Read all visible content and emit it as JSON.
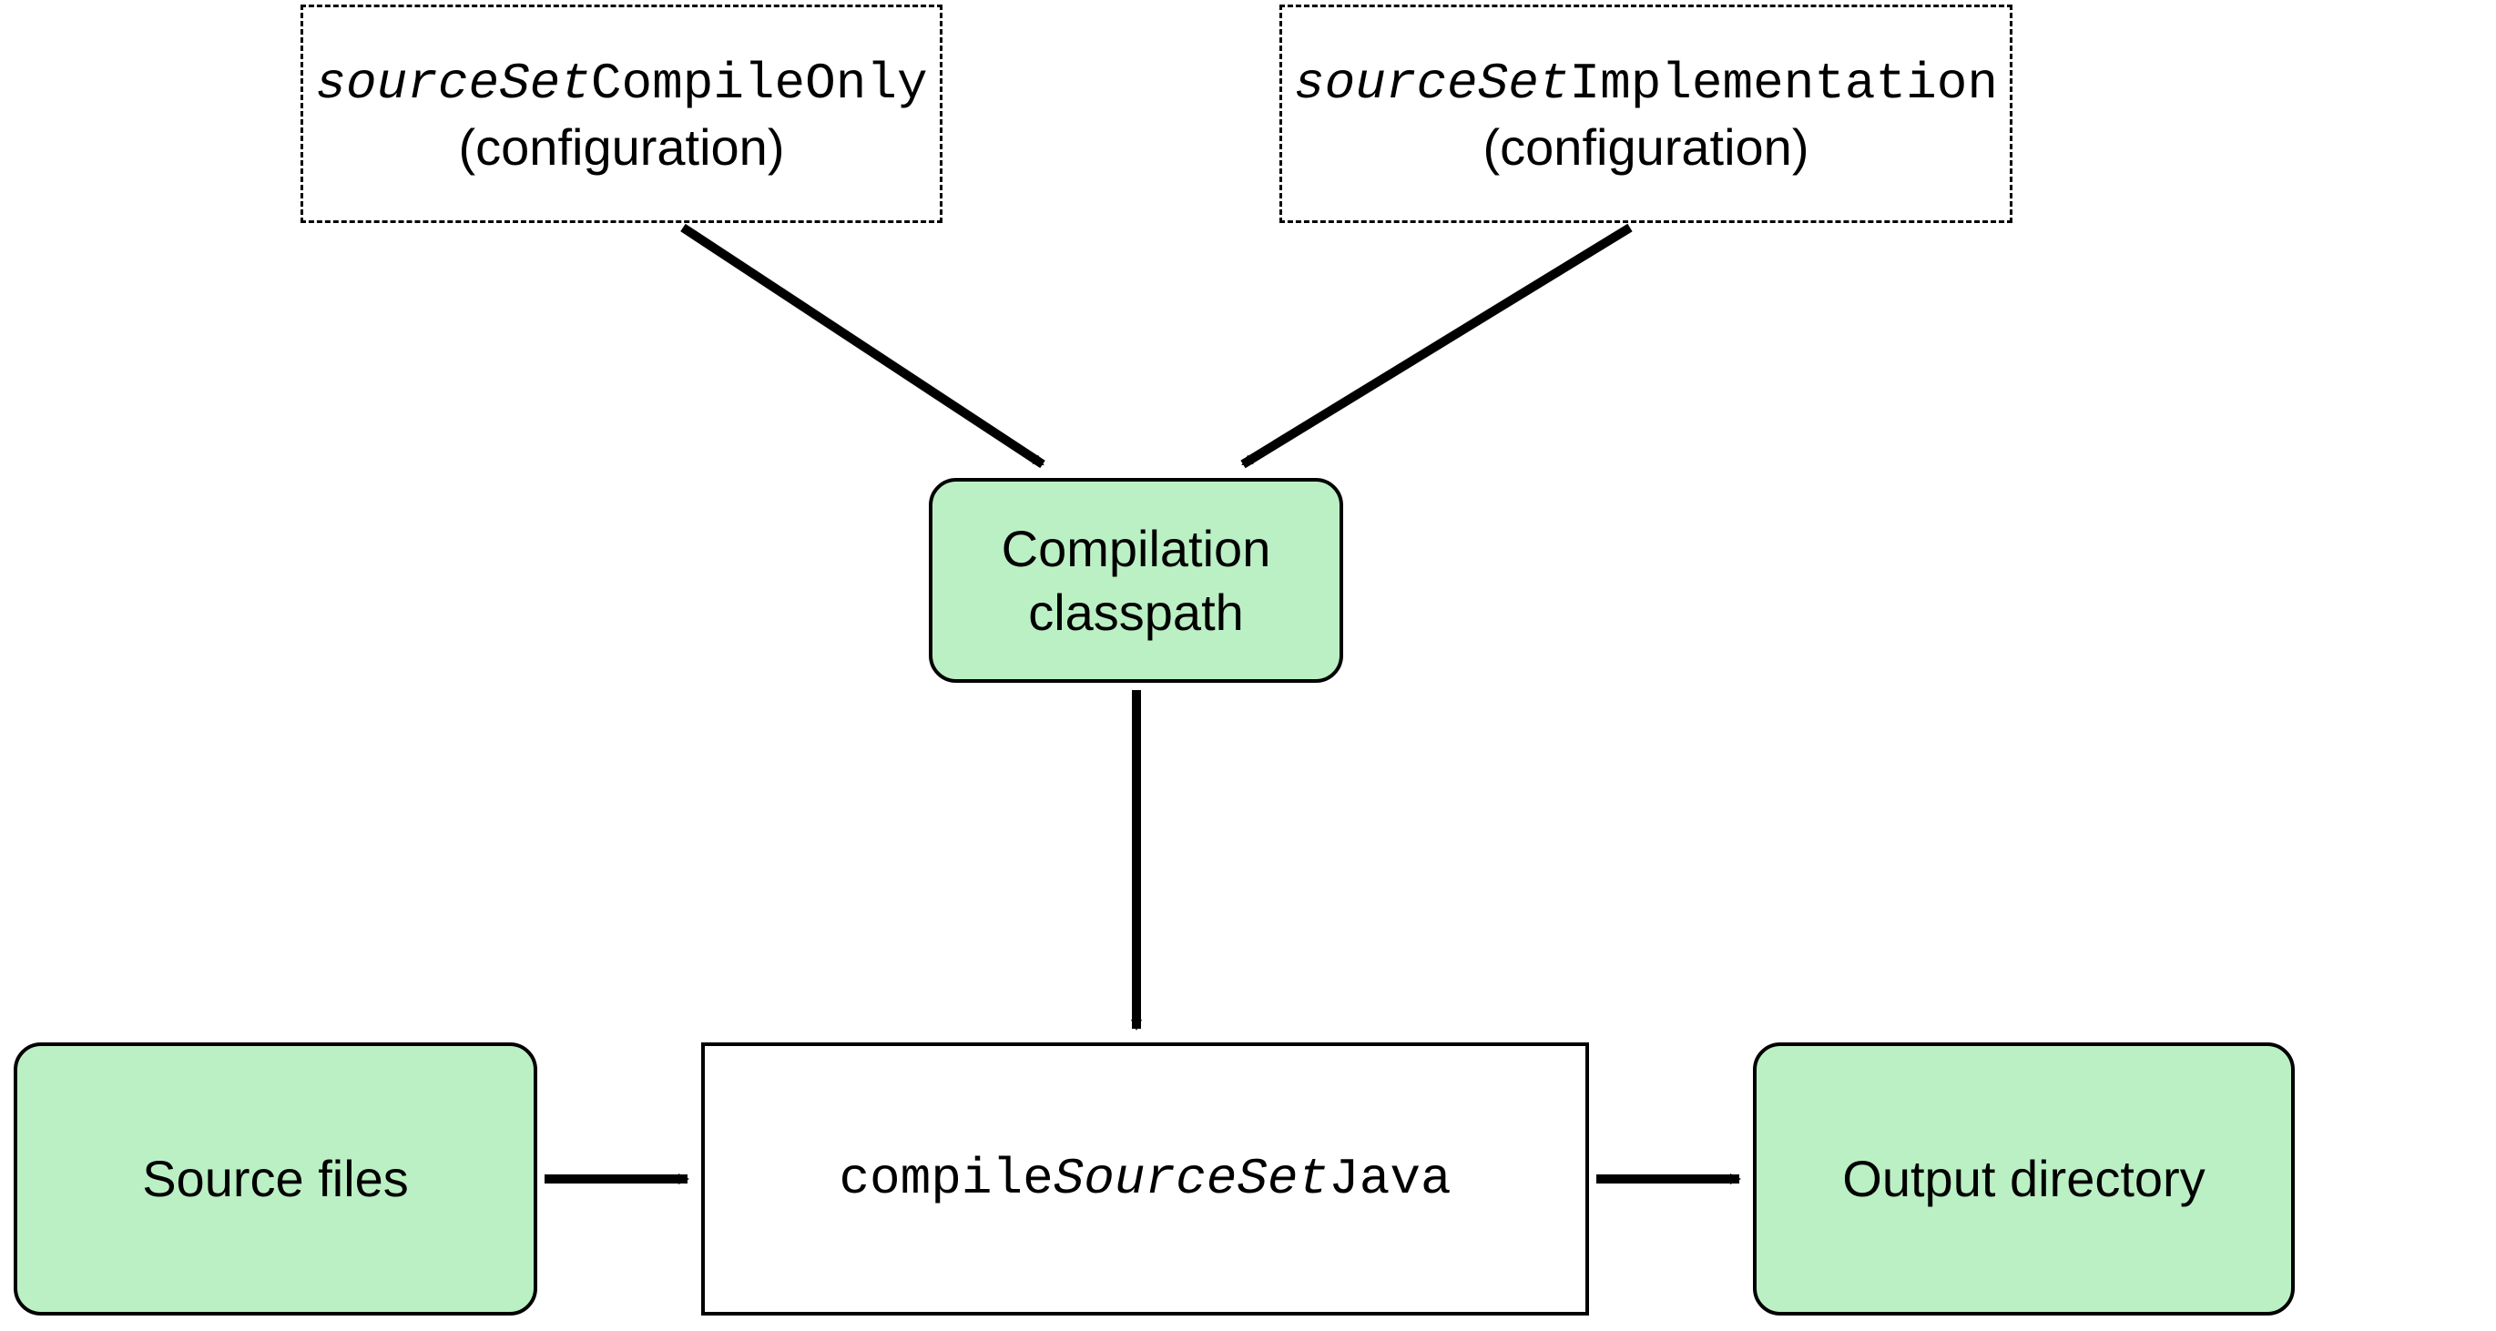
{
  "nodes": {
    "compileOnly": {
      "prefix_italic": "sourceSet",
      "suffix_mono": "CompileOnly",
      "subtext": "(configuration)"
    },
    "implementation": {
      "prefix_italic": "sourceSet",
      "suffix_mono": "Implementation",
      "subtext": "(configuration)"
    },
    "classpath": {
      "line1": "Compilation",
      "line2": "classpath"
    },
    "sourceFiles": {
      "label": "Source files"
    },
    "compileTask": {
      "prefix_mono": "compile",
      "mid_italic": "SourceSet",
      "suffix_mono": "Java"
    },
    "outputDir": {
      "label": "Output directory"
    }
  },
  "edges": [
    {
      "from": "compileOnly",
      "to": "classpath"
    },
    {
      "from": "implementation",
      "to": "classpath"
    },
    {
      "from": "classpath",
      "to": "compileTask"
    },
    {
      "from": "sourceFiles",
      "to": "compileTask"
    },
    {
      "from": "compileTask",
      "to": "outputDir"
    }
  ]
}
